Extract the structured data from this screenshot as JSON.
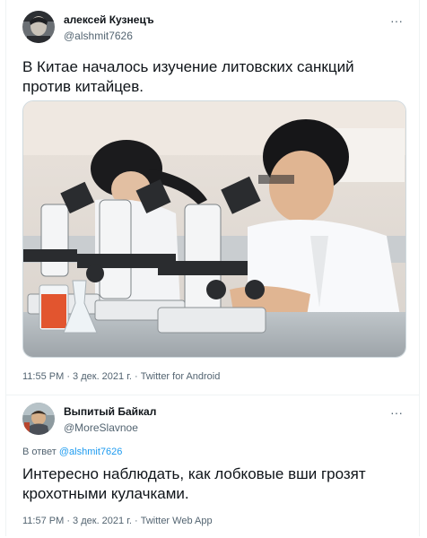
{
  "tweets": [
    {
      "display_name": "алексей Кузнецъ",
      "handle": "@alshmit7626",
      "text": "В Китае началось изучение литовских санкций против китайцев.",
      "timestamp": "11:55 PM · 3 дек. 2021 г. · Twitter for Android",
      "more_label": "···",
      "media": "photo-students-with-microscopes"
    },
    {
      "display_name": "Выпитый Байкал",
      "handle": "@MoreSlavnoe",
      "reply_prefix": "В ответ ",
      "reply_handle": "@alshmit7626",
      "text": "Интересно наблюдать, как лобковые вши грозят крохотными кулачками.",
      "timestamp": "11:57 PM · 3 дек. 2021 г. · Twitter Web App",
      "more_label": "···"
    }
  ],
  "colors": {
    "primary_text": "#0f1419",
    "secondary_text": "#536471",
    "link": "#1d9bf0",
    "divider": "#eff3f4"
  }
}
